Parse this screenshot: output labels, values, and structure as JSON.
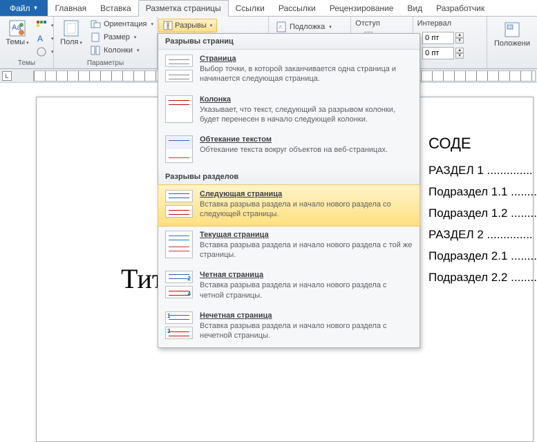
{
  "tabs": {
    "file": "Файл",
    "items": [
      "Главная",
      "Вставка",
      "Разметка страницы",
      "Ссылки",
      "Рассылки",
      "Рецензирование",
      "Вид",
      "Разработчик"
    ],
    "active_index": 2
  },
  "ribbon": {
    "themes_group": {
      "themes": "Темы",
      "label": "Темы"
    },
    "page_setup": {
      "margins": "Поля",
      "orientation": "Ориентация",
      "size": "Размер",
      "columns": "Колонки",
      "label": "Параметры"
    },
    "breaks_btn": "Разрывы",
    "watermark": "Подложка",
    "indent_label": "Отступ",
    "spacing_label": "Интервал",
    "spacing_before": "0 пт",
    "spacing_after": "0 пт",
    "arrange": "Положени"
  },
  "menu": {
    "section1": "Разрывы страниц",
    "section2": "Разрывы разделов",
    "items": [
      {
        "title": "Страница",
        "desc": "Выбор точки, в которой заканчивается одна страница и начинается следующая страница."
      },
      {
        "title": "Колонка",
        "desc": "Указывает, что текст, следующий за разрывом колонки, будет перенесен в начало следующей колонки."
      },
      {
        "title": "Обтекание текстом",
        "desc": "Обтекание текста вокруг объектов на веб-страницах."
      },
      {
        "title": "Следующая страница",
        "desc": "Вставка разрыва раздела и начало нового раздела со следующей страницы."
      },
      {
        "title": "Текущая страница",
        "desc": "Вставка разрыва раздела и начало нового раздела с той же страницы."
      },
      {
        "title": "Четная страница",
        "desc": "Вставка разрыва раздела и начало нового раздела с четной страницы."
      },
      {
        "title": "Нечетная страница",
        "desc": "Вставка разрыва раздела и начало нового раздела с нечетной страницы."
      }
    ]
  },
  "document": {
    "title_fragment": "Тит",
    "toc_head": "СОДЕ",
    "toc": [
      "РАЗДЕЛ 1 ..............",
      "Подраздел 1.1 ........",
      "Подраздел 1.2 ........",
      "РАЗДЕЛ 2 ..............",
      "Подраздел 2.1 ........",
      "Подраздел 2.2 ........"
    ]
  },
  "ruler_corner": "L",
  "icons": {
    "num2": "2",
    "num4": "4",
    "num1": "1",
    "num3": "3"
  }
}
